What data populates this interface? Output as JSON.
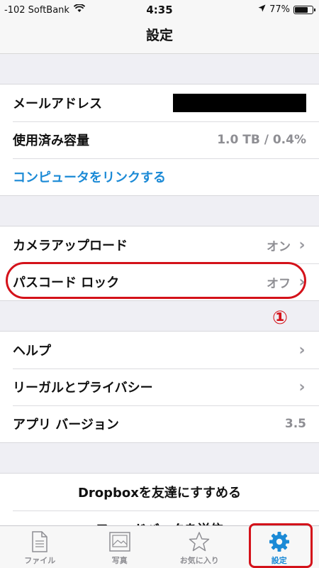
{
  "status": {
    "carrier": "-102 SoftBank",
    "time": "4:35",
    "battery": "77%",
    "battery_level": 0.77
  },
  "nav": {
    "title": "設定"
  },
  "account": {
    "email_label": "メールアドレス",
    "usage_label": "使用済み容量",
    "usage_value": "1.0 TB / 0.4%",
    "link_computer": "コンピュータをリンクする"
  },
  "features": {
    "camera_label": "カメラアップロード",
    "camera_value": "オン",
    "passcode_label": "パスコード ロック",
    "passcode_value": "オフ"
  },
  "annotation": {
    "marker": "①"
  },
  "about": {
    "help_label": "ヘルプ",
    "legal_label": "リーガルとプライバシー",
    "version_label": "アプリ バージョン",
    "version_value": "3.5"
  },
  "share": {
    "recommend": "Dropboxを友達にすすめる",
    "feedback": "フィードバックを送信"
  },
  "tabs": [
    {
      "label": "ファイル",
      "icon": "file-icon"
    },
    {
      "label": "写真",
      "icon": "photo-icon"
    },
    {
      "label": "お気に入り",
      "icon": "star-icon"
    },
    {
      "label": "設定",
      "icon": "gear-icon"
    }
  ],
  "colors": {
    "accent": "#1b8ad6",
    "annotation": "#d4121a"
  }
}
